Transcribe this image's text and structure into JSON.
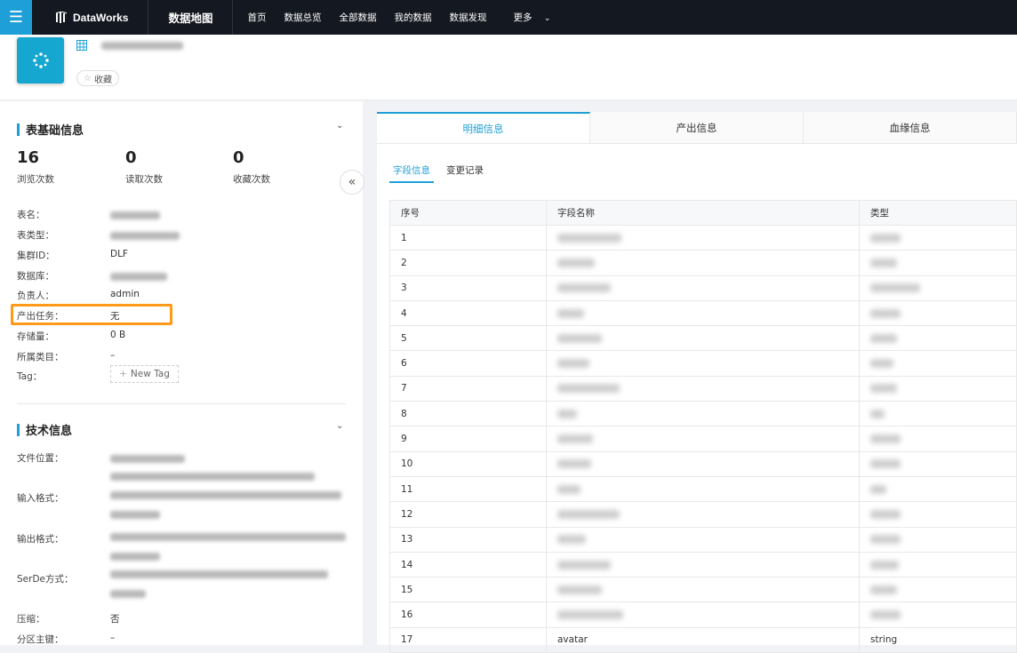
{
  "topbar": {
    "product": "DataWorks",
    "module": "数据地图",
    "nav": [
      "首页",
      "数据总览",
      "全部数据",
      "我的数据",
      "数据发现",
      "更多"
    ]
  },
  "header": {
    "table_name": "",
    "favorite_label": "收藏"
  },
  "basic": {
    "title": "表基础信息",
    "stats": [
      {
        "value": "16",
        "label": "浏览次数"
      },
      {
        "value": "0",
        "label": "读取次数"
      },
      {
        "value": "0",
        "label": "收藏次数"
      }
    ],
    "rows": [
      {
        "label": "表名：",
        "value": ""
      },
      {
        "label": "表类型：",
        "value": ""
      },
      {
        "label": "集群ID：",
        "value": "DLF"
      },
      {
        "label": "数据库：",
        "value": ""
      },
      {
        "label": "负责人：",
        "value": "admin"
      },
      {
        "label": "产出任务：",
        "value": "无"
      },
      {
        "label": "存储量：",
        "value": "0 B"
      },
      {
        "label": "所属类目：",
        "value": "–"
      },
      {
        "label": "Tag：",
        "value": ""
      }
    ],
    "new_tag_label": "New Tag"
  },
  "tech": {
    "title": "技术信息",
    "rows": [
      {
        "label": "文件位置：",
        "value": ""
      },
      {
        "label": "输入格式：",
        "value": ""
      },
      {
        "label": "输出格式：",
        "value": ""
      },
      {
        "label": "SerDe方式：",
        "value": ""
      },
      {
        "label": "压缩：",
        "value": "否"
      },
      {
        "label": "分区主键：",
        "value": "–"
      }
    ]
  },
  "tabs": [
    "明细信息",
    "产出信息",
    "血缘信息"
  ],
  "subtabs": [
    "字段信息",
    "变更记录"
  ],
  "fields_table": {
    "columns": [
      "序号",
      "字段名称",
      "类型"
    ],
    "rows": [
      [
        "1",
        "",
        ""
      ],
      [
        "2",
        "",
        ""
      ],
      [
        "3",
        "",
        ""
      ],
      [
        "4",
        "",
        ""
      ],
      [
        "5",
        "",
        ""
      ],
      [
        "6",
        "",
        ""
      ],
      [
        "7",
        "",
        ""
      ],
      [
        "8",
        "",
        ""
      ],
      [
        "9",
        "",
        ""
      ],
      [
        "10",
        "",
        ""
      ],
      [
        "11",
        "",
        ""
      ],
      [
        "12",
        "",
        ""
      ],
      [
        "13",
        "",
        ""
      ],
      [
        "14",
        "",
        ""
      ],
      [
        "15",
        "",
        ""
      ],
      [
        "16",
        "",
        ""
      ],
      [
        "17",
        "avatar",
        "string"
      ]
    ]
  },
  "colors": {
    "accent": "#1e9fd8",
    "highlight": "#ff9a1a",
    "topbar": "#141820"
  }
}
